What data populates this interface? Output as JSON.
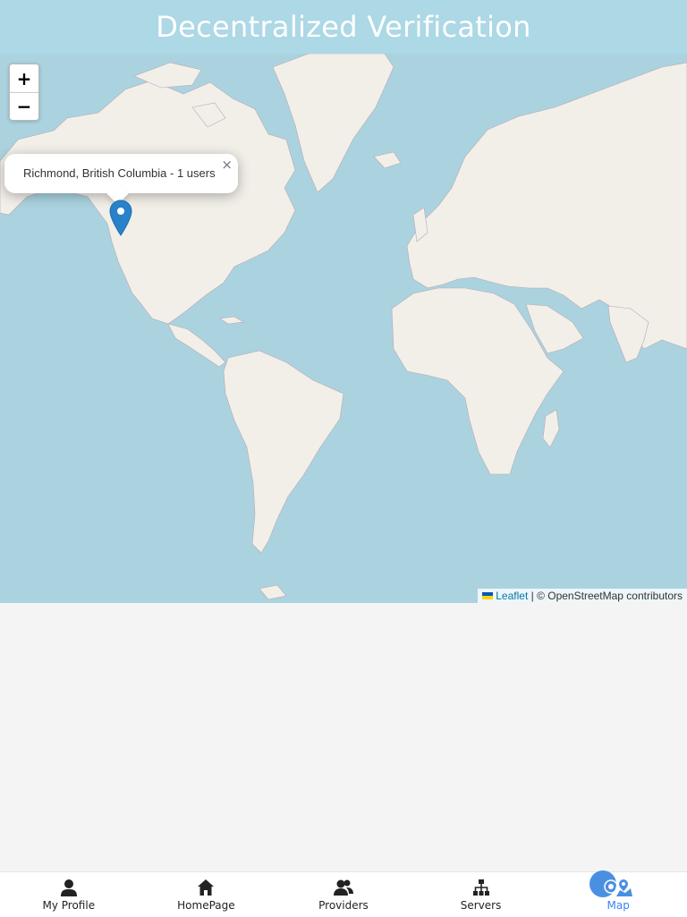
{
  "header": {
    "title": "Decentralized Verification"
  },
  "map": {
    "zoom_in_label": "+",
    "zoom_out_label": "−",
    "popup": {
      "text": "Richmond, British Columbia - 1 users",
      "close_label": "×"
    },
    "attribution": {
      "leaflet_label": "Leaflet",
      "separator": " | ",
      "osm_text": "© OpenStreetMap contributors"
    },
    "colors": {
      "water": "#aad3df",
      "land": "#f2efe9",
      "marker": "#2a81cb",
      "link": "#0078a8"
    }
  },
  "nav": {
    "items": [
      {
        "label": "My Profile",
        "icon": "user-icon"
      },
      {
        "label": "HomePage",
        "icon": "home-icon"
      },
      {
        "label": "Providers",
        "icon": "users-icon"
      },
      {
        "label": "Servers",
        "icon": "sitemap-icon"
      },
      {
        "label": "Map",
        "icon": "map-marker-icon",
        "active": true
      }
    ],
    "active_color": "#3b82f6"
  }
}
